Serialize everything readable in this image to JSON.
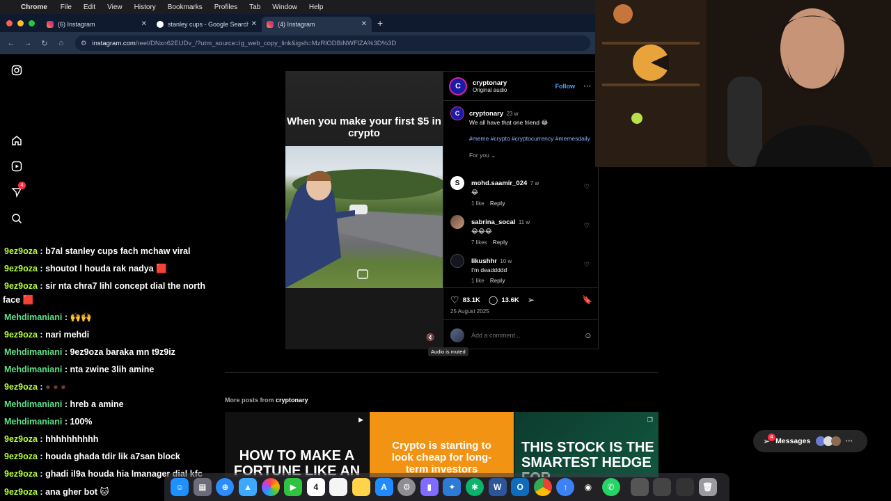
{
  "menubar": {
    "app_name": "Chrome",
    "items": [
      "File",
      "Edit",
      "View",
      "History",
      "Bookmarks",
      "Profiles",
      "Tab",
      "Window",
      "Help"
    ]
  },
  "tabs": [
    {
      "title": "(6) Instagram"
    },
    {
      "title": "stanley cups - Google Search"
    },
    {
      "title": "(4) Instagram"
    }
  ],
  "address": {
    "host": "instagram.com",
    "path": "/reel/DNxn62EUDv_/?utm_source=ig_web_copy_link&igsh=MzRlODBiNWFlZA%3D%3D"
  },
  "sidebar": {
    "notifications_badge": "4"
  },
  "reel": {
    "caption": "When you make your first $5 in crypto"
  },
  "post": {
    "author": "cryptonary",
    "audio": "Original audio",
    "follow_label": "Follow",
    "caption_author": "cryptonary",
    "caption_age": "23 w",
    "caption_text": "We all have that one friend 😂",
    "hashtags": "#meme #crypto #cryptocurrency #memesdaily",
    "sort_label": "For you",
    "comments": [
      {
        "user": "mohd.saamir_024",
        "age": "7 w",
        "text": "😂",
        "likes": "1 like",
        "reply": "Reply"
      },
      {
        "user": "sabrina_socal",
        "age": "11 w",
        "text": "😂😂😂",
        "likes": "7 likes",
        "reply": "Reply"
      },
      {
        "user": "likushhr",
        "age": "10 w",
        "text": "I'm deaddddd",
        "likes": "1 like",
        "reply": "Reply"
      }
    ],
    "like_count": "83.1K",
    "comment_count": "13.6K",
    "date": "25 August 2025",
    "comment_placeholder": "Add a comment..."
  },
  "tooltip": "Audio is muted",
  "more_posts": {
    "prefix": "More posts from",
    "author": "cryptonary",
    "thumbs": [
      {
        "title": "HOW TO MAKE A FORTUNE LIKE AN EXCHANGE"
      },
      {
        "title": "Crypto is starting to look cheap for long-term investors"
      },
      {
        "title": "THIS STOCK IS THE SMARTEST HEDGE FOR"
      }
    ]
  },
  "messages": {
    "label": "Messages",
    "badge": "4"
  },
  "chat": [
    {
      "user": "9ez9oza",
      "msg": "b7al stanley cups fach mchaw viral"
    },
    {
      "user": "9ez9oza",
      "msg": "shoutot l houda rak nadya 🟥"
    },
    {
      "user": "9ez9oza",
      "msg": "sir nta chra7 lihl concept dial the north"
    },
    {
      "user": "",
      "msg": "face 🟥"
    },
    {
      "user": "Mehdimaniani",
      "msg": "🙌🙌"
    },
    {
      "user": "9ez9oza",
      "msg": "nari mehdi"
    },
    {
      "user": "Mehdimaniani",
      "msg": "9ez9oza baraka mn t9z9iz"
    },
    {
      "user": "Mehdimaniani",
      "msg": "nta zwine 3lih amine"
    },
    {
      "user": "9ez9oza",
      "msg": "● ● ●"
    },
    {
      "user": "Mehdimaniani",
      "msg": "hreb a amine"
    },
    {
      "user": "Mehdimaniani",
      "msg": "100%"
    },
    {
      "user": "9ez9oza",
      "msg": "hhhhhhhhhh"
    },
    {
      "user": "9ez9oza",
      "msg": "houda ghada tdir lik a7san block"
    },
    {
      "user": "9ez9oza",
      "msg": "ghadi il9a houda hia lmanager dial kfc"
    },
    {
      "user": "9ez9oza",
      "msg": "ana gher bot 🐱"
    }
  ],
  "dock": {
    "calendar_day": "4"
  }
}
